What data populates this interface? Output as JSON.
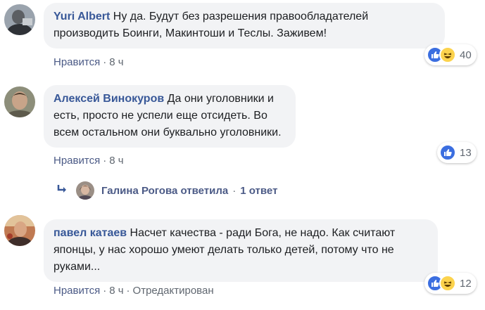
{
  "comments": [
    {
      "author": "Yuri Albert",
      "text": "Ну да. Будут без разрешения правообладателей производить Боинги, Макинтоши и Теслы. Заживем!",
      "like_label": "Нравится",
      "time": "8 ч",
      "reactions": [
        "like",
        "haha"
      ],
      "reaction_count": "40"
    },
    {
      "author": "Алексей Винокуров",
      "text": "Да они уголовники и есть, просто не успели еще отсидеть. Во всем остальном они буквально уголовники.",
      "like_label": "Нравится",
      "time": "8 ч",
      "reactions": [
        "like"
      ],
      "reaction_count": "13"
    },
    {
      "author": "павел катаев",
      "text": "Насчет качества - ради Бога, не надо. Как считают японцы, у нас хорошо умеют делать только детей, потому что не руками...",
      "like_label": "Нравится",
      "time": "8 ч",
      "edited": "Отредактирован",
      "reactions": [
        "like",
        "haha"
      ],
      "reaction_count": "12"
    }
  ],
  "reply": {
    "text": "Галина Рогова ответила",
    "count": "1 ответ",
    "icon": "reply-arrow-icon"
  },
  "colors": {
    "author": "#385898",
    "bubble": "#f2f3f5",
    "meta": "#606770",
    "like_icon": "#3b6ee0",
    "haha_icon": "#fcd34d"
  }
}
